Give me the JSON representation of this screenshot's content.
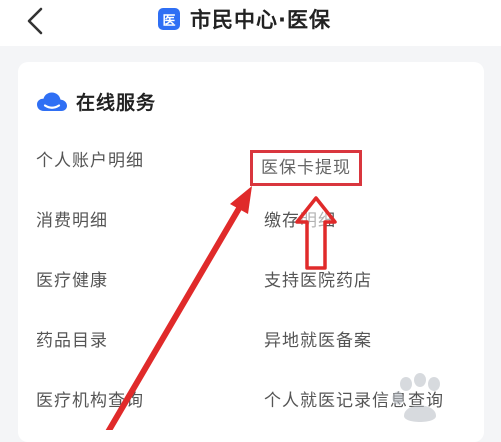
{
  "header": {
    "back_icon": "chevron-left-icon",
    "app_badge": "医",
    "title": "市民中心·医保"
  },
  "online_services": {
    "icon": "cloud-icon",
    "title": "在线服务",
    "items": [
      "个人账户明细",
      "医保卡提现",
      "消费明细",
      "缴存明细",
      "医疗健康",
      "支持医院药店",
      "药品目录",
      "异地就医备案",
      "医疗机构查询",
      "个人就医记录信息查询"
    ],
    "highlighted_item": "医保卡提现"
  },
  "annotation": {
    "color": "#e02a2a"
  },
  "colors": {
    "accent": "#2f6ff4",
    "highlight_box": "#d9363e"
  }
}
